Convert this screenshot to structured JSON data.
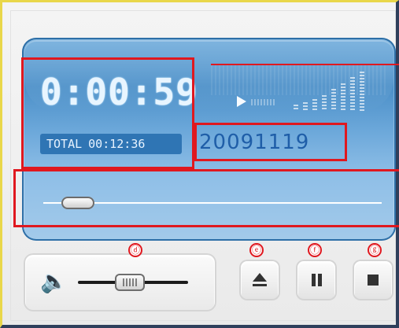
{
  "display": {
    "elapsed_time": "0:00:59",
    "total_label": "TOTAL",
    "total_time": "00:12:36",
    "track_id": "20091119"
  },
  "seek": {
    "progress": 0.06
  },
  "volume": {
    "level": 0.46
  },
  "equalizer": {
    "bars": [
      0.15,
      0.22,
      0.3,
      0.4,
      0.55,
      0.7,
      0.85,
      1.0
    ]
  },
  "annotations": {
    "callouts": [
      "ⓓ",
      "ⓔ",
      "ⓕ",
      "ⓖ"
    ],
    "color": "#e0181f"
  },
  "buttons": {
    "eject": "eject-icon",
    "pause": "pause-icon",
    "stop": "stop-icon"
  },
  "colors": {
    "display_top": "#4b8fc8",
    "display_bottom": "#a3caea",
    "total_box": "#2f75b4",
    "track_id_text": "#1f5ea8"
  }
}
